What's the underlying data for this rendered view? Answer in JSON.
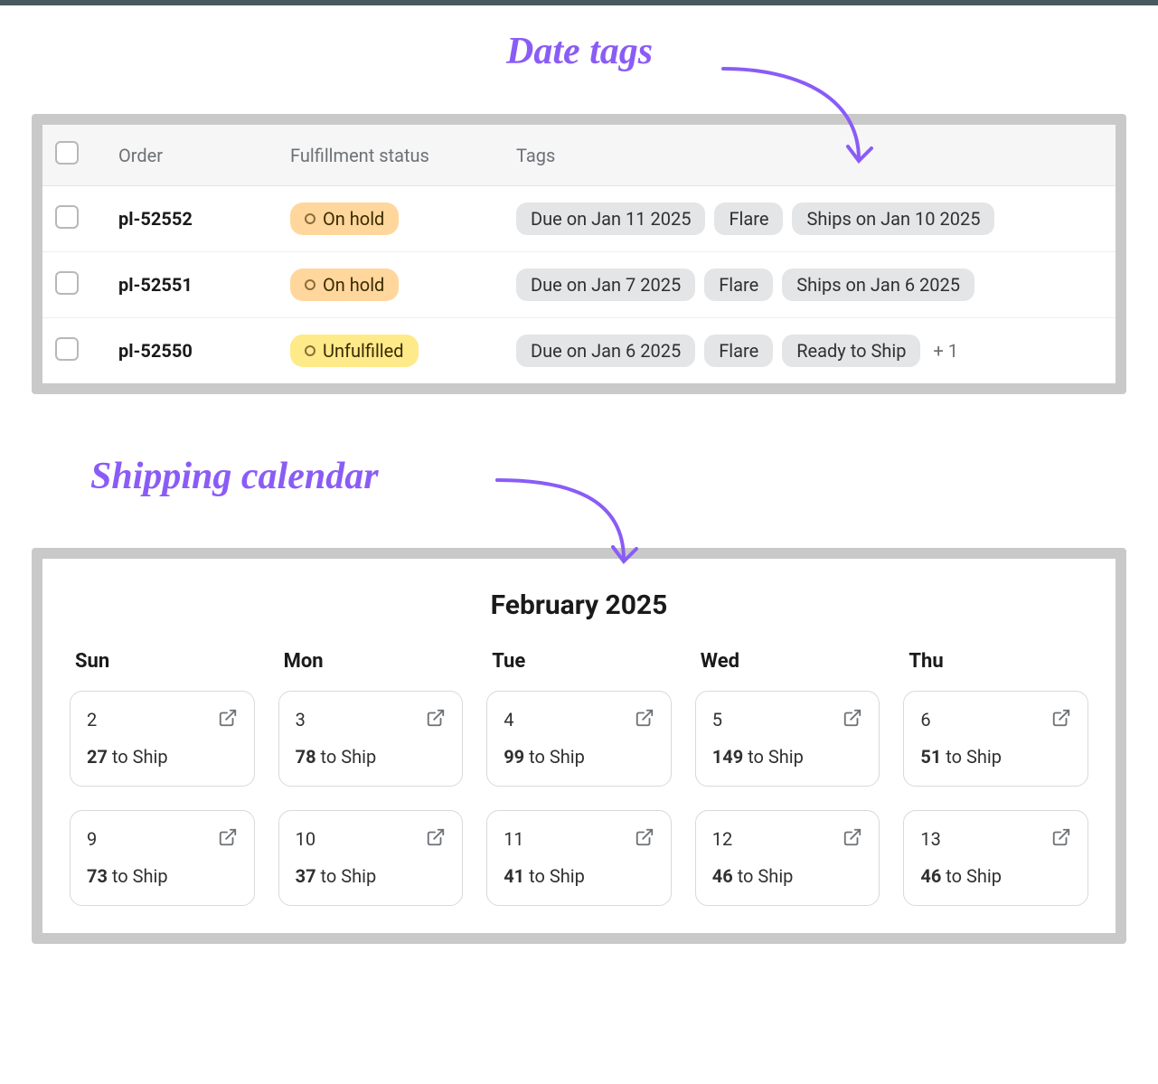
{
  "annotations": {
    "date_tags": "Date tags",
    "shipping_calendar": "Shipping calendar"
  },
  "orders_table": {
    "columns": {
      "order": "Order",
      "fulfillment": "Fulfillment status",
      "tags": "Tags"
    },
    "rows": [
      {
        "id": "pl-52552",
        "status_label": "On hold",
        "status_class": "status-on-hold",
        "tags": [
          "Due on Jan 11 2025",
          "Flare",
          "Ships on Jan 10 2025"
        ],
        "more": ""
      },
      {
        "id": "pl-52551",
        "status_label": "On hold",
        "status_class": "status-on-hold",
        "tags": [
          "Due on Jan 7 2025",
          "Flare",
          "Ships on Jan 6 2025"
        ],
        "more": ""
      },
      {
        "id": "pl-52550",
        "status_label": "Unfulfilled",
        "status_class": "status-unfulfilled",
        "tags": [
          "Due on Jan 6 2025",
          "Flare",
          "Ready to Ship"
        ],
        "more": "+ 1"
      }
    ]
  },
  "calendar": {
    "title": "February 2025",
    "day_headers": [
      "Sun",
      "Mon",
      "Tue",
      "Wed",
      "Thu"
    ],
    "suffix": "to Ship",
    "cells": [
      {
        "date": "2",
        "count": "27"
      },
      {
        "date": "3",
        "count": "78"
      },
      {
        "date": "4",
        "count": "99"
      },
      {
        "date": "5",
        "count": "149"
      },
      {
        "date": "6",
        "count": "51"
      },
      {
        "date": "9",
        "count": "73"
      },
      {
        "date": "10",
        "count": "37"
      },
      {
        "date": "11",
        "count": "41"
      },
      {
        "date": "12",
        "count": "46"
      },
      {
        "date": "13",
        "count": "46"
      }
    ]
  }
}
